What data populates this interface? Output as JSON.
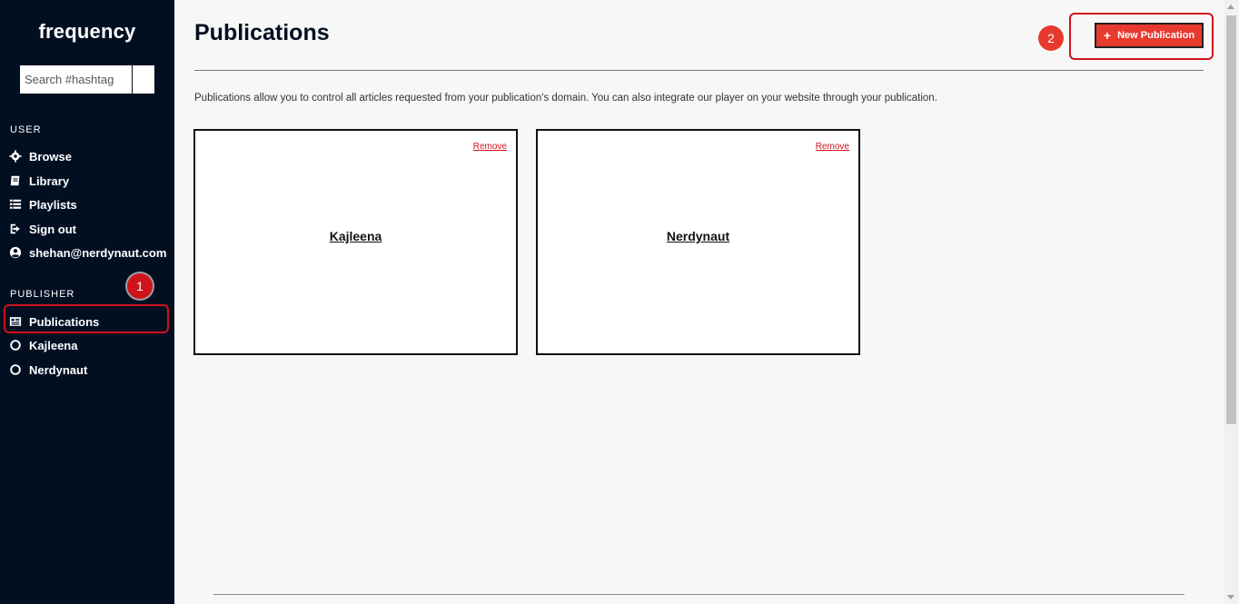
{
  "brand": {
    "name_part1": "freq",
    "name_part2": "uency"
  },
  "search": {
    "placeholder": "Search #hashtag"
  },
  "sidebar": {
    "user_label": "USER",
    "user_items": [
      {
        "label": "Browse",
        "icon": "gear-icon"
      },
      {
        "label": "Library",
        "icon": "book-icon"
      },
      {
        "label": "Playlists",
        "icon": "list-icon"
      },
      {
        "label": "Sign out",
        "icon": "sign-out-icon"
      },
      {
        "label": "shehan@nerdynaut.com",
        "icon": "user-circle-icon"
      }
    ],
    "publisher_label": "PUBLISHER",
    "publisher_items": [
      {
        "label": "Publications",
        "icon": "newspaper-icon"
      },
      {
        "label": "Kajleena",
        "icon": "circle-icon"
      },
      {
        "label": "Nerdynaut",
        "icon": "circle-icon"
      }
    ]
  },
  "annotations": {
    "step1": "1",
    "step2": "2"
  },
  "main": {
    "title": "Publications",
    "new_button": "New Publication",
    "description": "Publications allow you to control all articles requested from your publication's domain. You can also integrate our player on your website through your publication.",
    "cards": [
      {
        "title": "Kajleena",
        "remove": "Remove"
      },
      {
        "title": "Nerdynaut",
        "remove": "Remove"
      }
    ]
  },
  "colors": {
    "sidebar_bg": "#020f21",
    "accent": "#e8392f",
    "highlight": "#d0121b"
  }
}
